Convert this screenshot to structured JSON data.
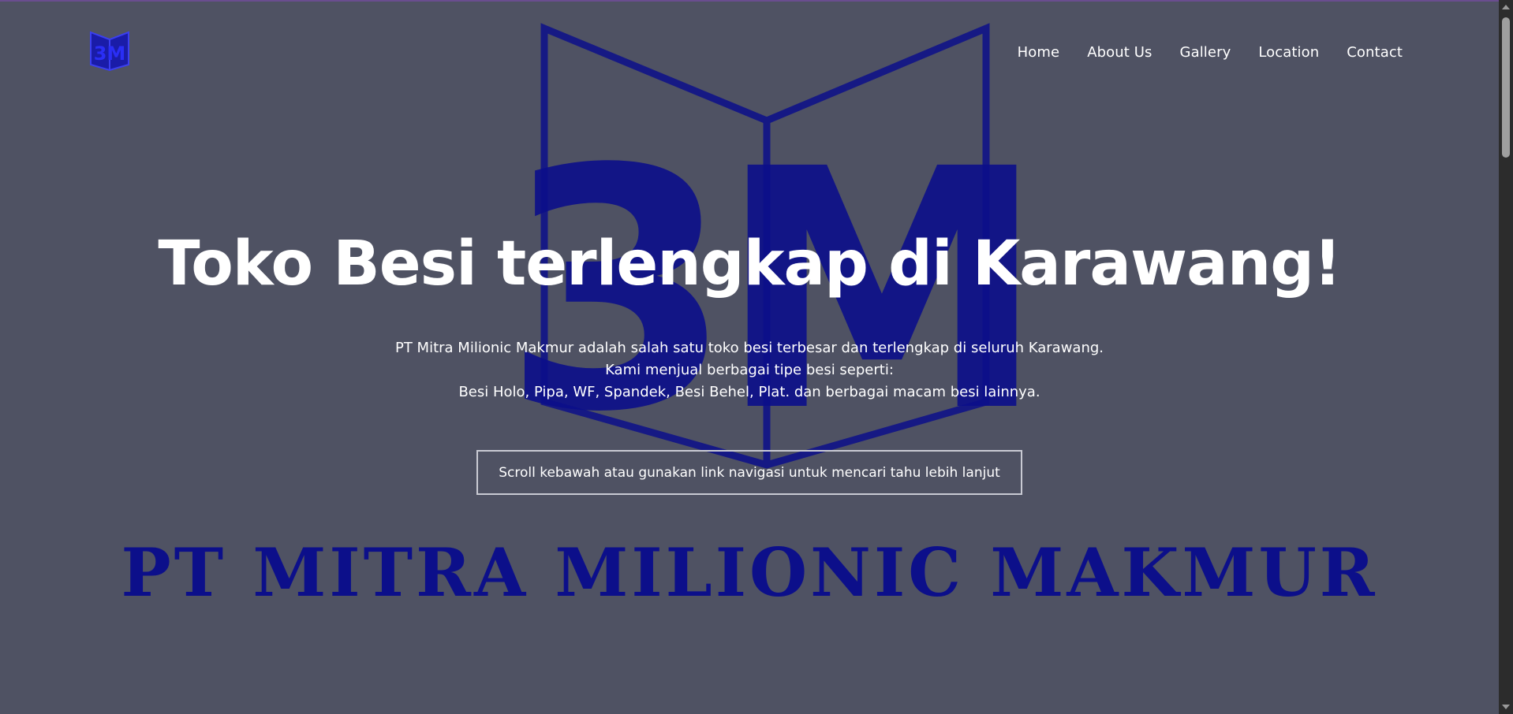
{
  "brand": {
    "logo_text": "3M",
    "logo_icon": "3m-logo-icon"
  },
  "nav": {
    "items": [
      {
        "label": "Home"
      },
      {
        "label": "About Us"
      },
      {
        "label": "Gallery"
      },
      {
        "label": "Location"
      },
      {
        "label": "Contact"
      }
    ]
  },
  "hero": {
    "title": "Toko Besi terlengkap di Karawang!",
    "description": [
      "PT Mitra Milionic Makmur adalah salah satu toko besi terbesar dan terlengkap di seluruh Karawang.",
      "Kami menjual berbagai tipe besi seperti:",
      "Besi Holo, Pipa, WF, Spandek, Besi Behel, Plat. dan berbagai macam besi lainnya."
    ],
    "cta_label": "Scroll kebawah atau gunakan link navigasi untuk mencari tahu lebih lanjut",
    "emblem_text": "3M",
    "company_name": "PT MITRA MILIONIC MAKMUR"
  },
  "colors": {
    "background": "#4f5263",
    "emblem": "#0c0f8a",
    "text": "#ffffff",
    "cta_border": "#c9cad3"
  }
}
